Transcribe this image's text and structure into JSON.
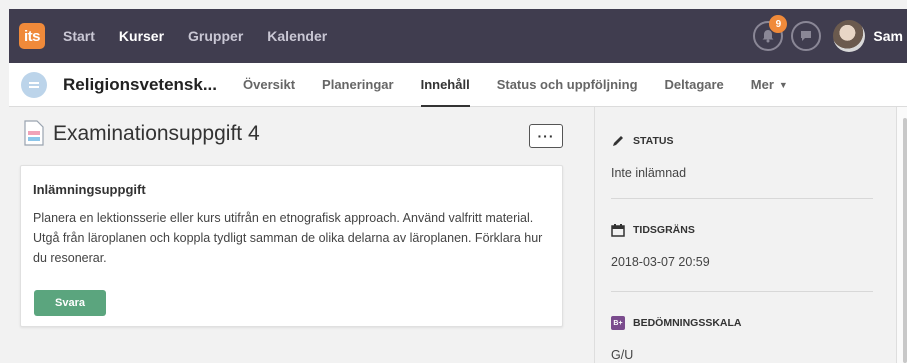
{
  "topbar": {
    "logo_text": "its",
    "nav": [
      "Start",
      "Kurser",
      "Grupper",
      "Kalender"
    ],
    "active_nav": "Kurser",
    "notification_count": "9",
    "user_name": "Sam"
  },
  "course": {
    "title": "Religionsvetensk...",
    "tabs": [
      "Översikt",
      "Planeringar",
      "Innehåll",
      "Status och uppföljning",
      "Deltagare",
      "Mer"
    ],
    "active_tab": "Innehåll"
  },
  "main": {
    "page_title": "Examinationsuppgift 4",
    "more_label": "···",
    "card_heading": "Inlämningsuppgift",
    "card_body": "Planera en lektionsserie eller kurs utifrån en etnografisk approach. Använd valfritt material. Utgå från läroplanen och koppla tydligt samman de olika delarna av läroplanen. Förklara hur du resonerar.",
    "answer_button": "Svara"
  },
  "sidebar": {
    "status_label": "Status",
    "status_value": "Inte inlämnad",
    "deadline_label": "Tidsgräns",
    "deadline_value": "2018-03-07 20:59",
    "scale_label": "Bedömningsskala",
    "scale_icon_text": "B+",
    "scale_value": "G/U"
  },
  "colors": {
    "topbar_bg": "#403d4f",
    "logo_accent": "#f08a3a",
    "answer_button": "#5ba57e"
  }
}
